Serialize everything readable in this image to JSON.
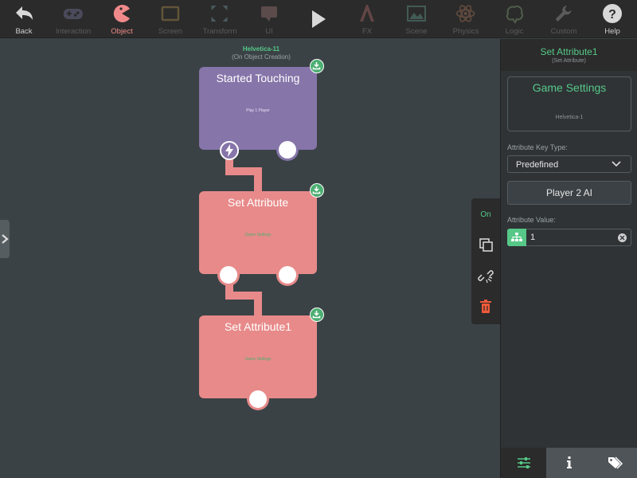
{
  "toolbar": {
    "items": [
      {
        "label": "Back",
        "icon": "back-arrow-icon",
        "state": "normal"
      },
      {
        "label": "Interaction",
        "icon": "gamepad-icon",
        "state": "disabled"
      },
      {
        "label": "Object",
        "icon": "pacman-icon",
        "state": "active"
      },
      {
        "label": "Screen",
        "icon": "screen-icon",
        "state": "disabled"
      },
      {
        "label": "Transform",
        "icon": "transform-icon",
        "state": "disabled"
      },
      {
        "label": "UI",
        "icon": "ui-icon",
        "state": "disabled"
      },
      {
        "label": "",
        "icon": "play-icon",
        "state": "normal"
      },
      {
        "label": "FX",
        "icon": "fx-icon",
        "state": "disabled"
      },
      {
        "label": "Scene",
        "icon": "scene-icon",
        "state": "disabled"
      },
      {
        "label": "Physics",
        "icon": "atom-icon",
        "state": "disabled"
      },
      {
        "label": "Logic",
        "icon": "brain-icon",
        "state": "disabled"
      },
      {
        "label": "Custom",
        "icon": "wrench-icon",
        "state": "disabled"
      },
      {
        "label": "Help",
        "icon": "help-icon",
        "state": "normal"
      }
    ]
  },
  "canvas": {
    "object_name": "Helvetica-11",
    "object_trigger": "(On Object Creation)",
    "blocks": [
      {
        "title": "Started Touching",
        "subtitle": "Play 1 Player"
      },
      {
        "title": "Set Attribute",
        "subtitle": "Game Settings"
      },
      {
        "title": "Set Attribute1",
        "subtitle": "Game Settings"
      }
    ]
  },
  "side_toolbar": {
    "on_label": "On"
  },
  "inspector": {
    "title": "Set Attribute1",
    "subtitle": "(Set Attribute)",
    "target_name": "Game Settings",
    "target_sub": "Helvetica-1",
    "key_type_label": "Attribute Key Type:",
    "key_type_value": "Predefined",
    "key_button": "Player 2 AI",
    "value_label": "Attribute Value:",
    "value": "1"
  },
  "colors": {
    "accent_green": "#56c887",
    "block_purple": "#8675a9",
    "block_red": "#e88a8a",
    "active_pink": "#f08a8a"
  }
}
